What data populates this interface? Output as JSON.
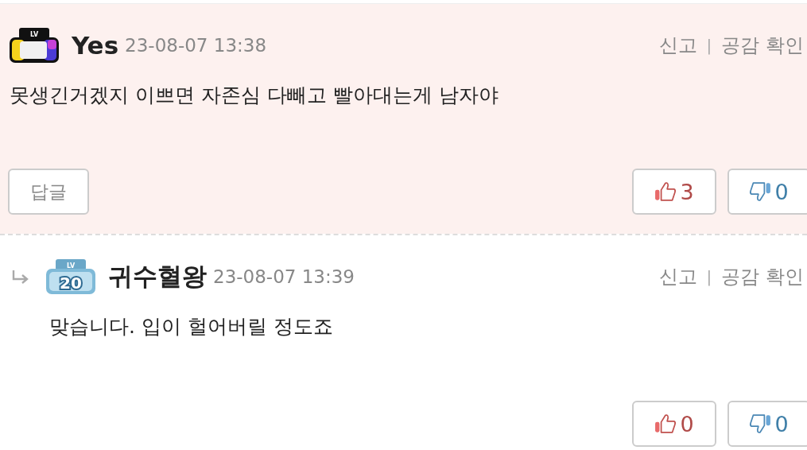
{
  "comments": [
    {
      "is_reply": false,
      "highlighted": true,
      "badge": {
        "kind": "rainbow",
        "label": "LV"
      },
      "author": "Yes",
      "time": "23-08-07 13:38",
      "report": "신고",
      "sep": "|",
      "likes_link": "공감 확인",
      "body": "못생긴거겠지 이쁘면 자존심 다빼고 빨아대는게 남자야",
      "reply_button": "답글",
      "up": "3",
      "down": "0"
    },
    {
      "is_reply": true,
      "highlighted": false,
      "badge": {
        "kind": "blue",
        "label": "LV",
        "number": "20"
      },
      "author": "귀수혈왕",
      "time": "23-08-07 13:39",
      "report": "신고",
      "sep": "|",
      "likes_link": "공감 확인",
      "body": "맞습니다. 입이 헐어버릴 정도죠",
      "up": "0",
      "down": "0"
    }
  ]
}
